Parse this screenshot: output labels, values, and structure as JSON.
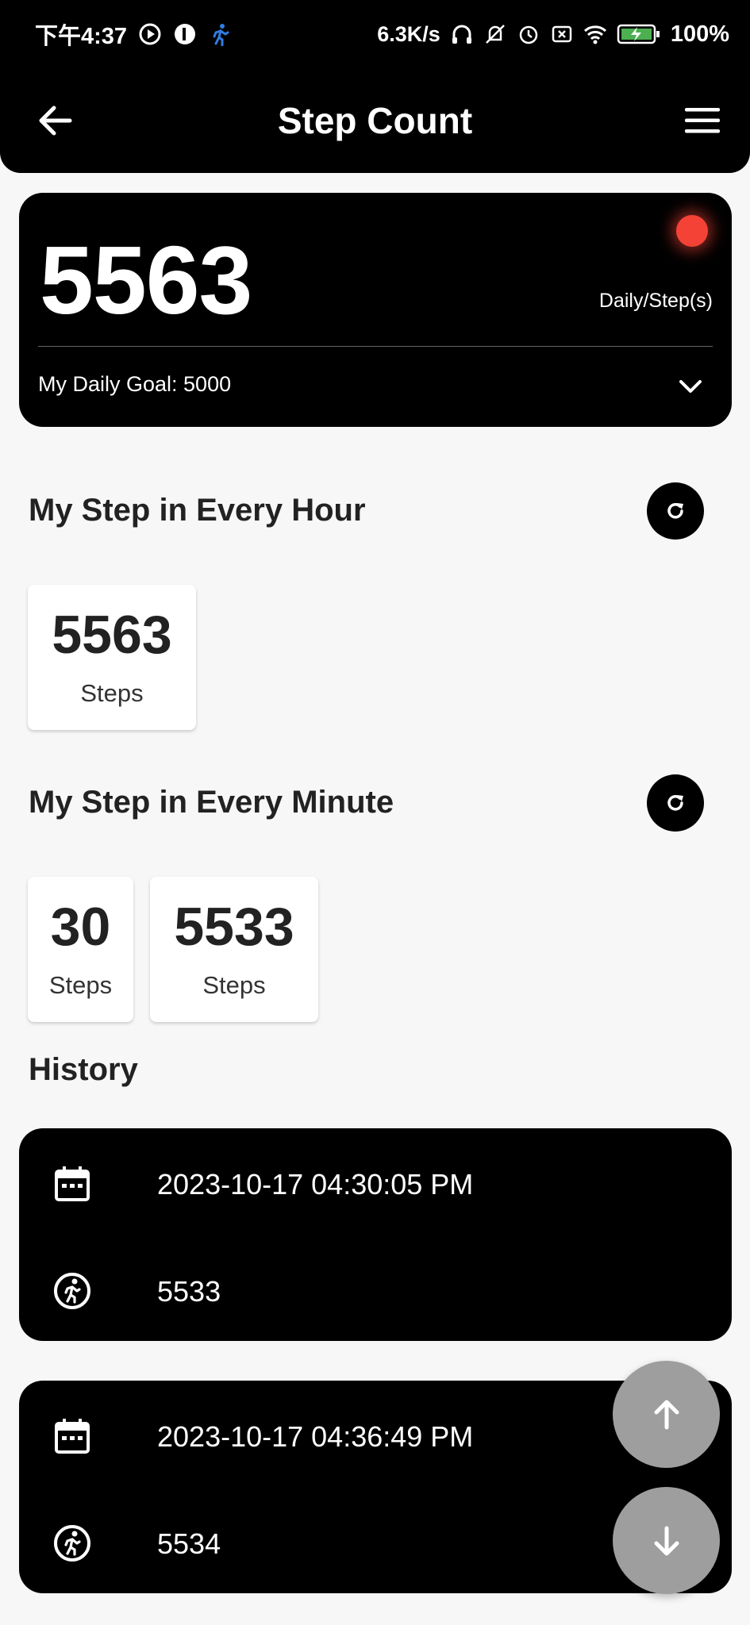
{
  "status_bar": {
    "time": "下午4:37",
    "network_speed": "6.3K/s",
    "battery": "100%",
    "icons": [
      "media-icon",
      "app-icon",
      "running-icon",
      "headphones-icon",
      "mute-icon",
      "alarm-icon",
      "sim-icon",
      "wifi-icon",
      "battery-icon"
    ]
  },
  "app_bar": {
    "title": "Step Count",
    "back_icon": "arrow-left-icon",
    "menu_icon": "hamburger-menu-icon"
  },
  "summary": {
    "steps": "5563",
    "unit_label": "Daily/Step(s)",
    "goal_text": "My Daily Goal: 5000",
    "status_color": "#f44336"
  },
  "hourly": {
    "title": "My Step in Every Hour",
    "cards": [
      {
        "value": "5563",
        "label": "Steps"
      }
    ]
  },
  "minutely": {
    "title": "My Step in Every Minute",
    "cards": [
      {
        "value": "30",
        "label": "Steps"
      },
      {
        "value": "5533",
        "label": "Steps"
      }
    ]
  },
  "history": {
    "title": "History",
    "items": [
      {
        "datetime": "2023-10-17 04:30:05 PM",
        "steps": "5533"
      },
      {
        "datetime": "2023-10-17 04:36:49 PM",
        "steps": "5534"
      }
    ]
  }
}
